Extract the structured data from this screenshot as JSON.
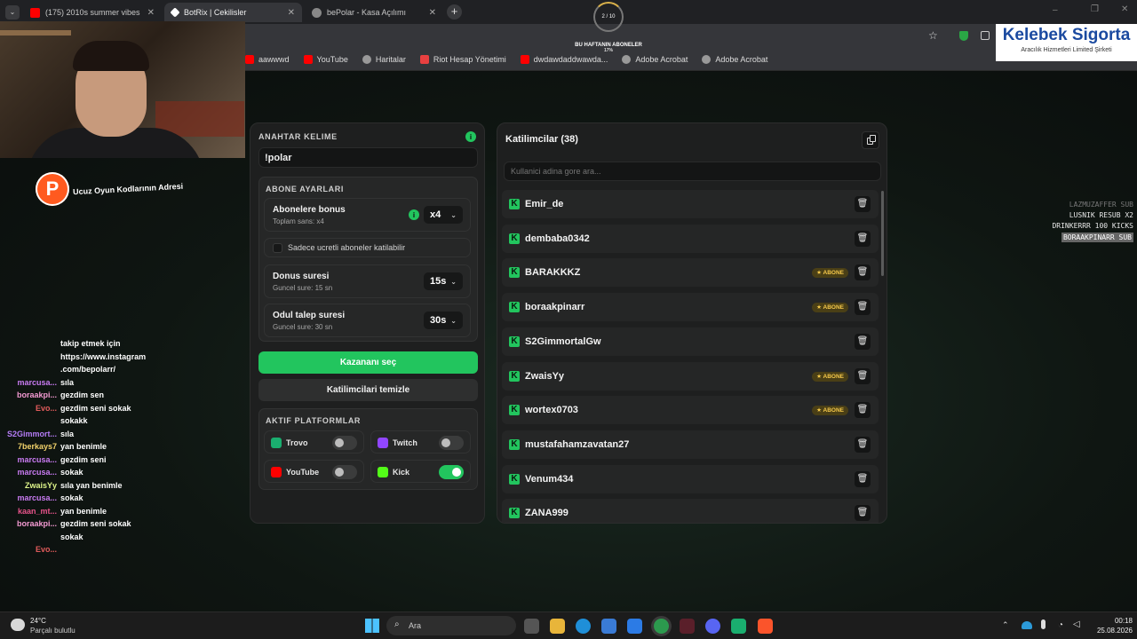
{
  "browser": {
    "tabs": [
      {
        "title": "(175) 2010s summer vibes mix",
        "fav_color": "#ff0000"
      },
      {
        "title": "BotRix | Cekilisler",
        "fav_color": "#ffffff"
      },
      {
        "title": "bePolar - Kasa Açılımı",
        "fav_color": "#888888"
      }
    ],
    "new_tab": "+",
    "bookmarks": [
      "aawwwd",
      "YouTube",
      "Haritalar",
      "Riot Hesap Yönetimi",
      "dwdawdaddwawda...",
      "Adobe Acrobat",
      "Adobe Acrobat"
    ]
  },
  "overlay": {
    "subs_banner": "BU HAFTANIN ABONELER",
    "subs_banner_sub": "17%",
    "progress_text": "2 / 10",
    "sponsor_name": "Kelebek Sigorta",
    "sponsor_sub": "Aracılık Hizmetleri Limited Şirketi",
    "logo_letter": "P",
    "logo_text": "Ucuz Oyun Kodlarının Adresi",
    "ticker": [
      "LAZMUZAFFER SUB",
      "LUSNIK RESUB X2",
      "DRINKERRR 100 KICKS",
      "BORAAKPINARR SUB"
    ]
  },
  "chat": [
    {
      "user": "",
      "color": "#ffffff",
      "msg": "takip etmek için"
    },
    {
      "user": "",
      "color": "#ffffff",
      "msg": "https://www.instagram"
    },
    {
      "user": "",
      "color": "#ffffff",
      "msg": ".com/bepolarr/"
    },
    {
      "user": "marcusa...",
      "color": "#c97bf2",
      "msg": "sıla"
    },
    {
      "user": "boraakpi...",
      "color": "#f39ad2",
      "msg": "gezdim sen"
    },
    {
      "user": "Evo...",
      "color": "#e05b5b",
      "msg": "gezdim seni sokak"
    },
    {
      "user": "",
      "color": "#ffffff",
      "msg": "sokakk"
    },
    {
      "user": "S2Gimmort...",
      "color": "#b47cf5",
      "msg": "sıla"
    },
    {
      "user": "7berkays7",
      "color": "#f3d36b",
      "msg": "yan benimle"
    },
    {
      "user": "marcusa...",
      "color": "#c97bf2",
      "msg": "gezdim seni"
    },
    {
      "user": "marcusa...",
      "color": "#c97bf2",
      "msg": "sokak"
    },
    {
      "user": "ZwaisYy",
      "color": "#dff58a",
      "msg": "sıla yan benimle"
    },
    {
      "user": "marcusa...",
      "color": "#c97bf2",
      "msg": "sokak"
    },
    {
      "user": "kaan_mt...",
      "color": "#e6538a",
      "msg": "yan benimle"
    },
    {
      "user": "boraakpi...",
      "color": "#f39ad2",
      "msg": "gezdim seni sokak"
    },
    {
      "user": "",
      "color": "#ffffff",
      "msg": "sokak"
    },
    {
      "user": "Evo...",
      "color": "#e05b5b",
      "msg": ""
    }
  ],
  "left_panel": {
    "keyword_label": "ANAHTAR KELIME",
    "keyword_value": "!polar",
    "abone_label": "ABONE AYARLARI",
    "bonus_title": "Abonelere bonus",
    "bonus_sub": "Toplam sans: x4",
    "bonus_value": "x4",
    "only_paid": "Sadece ucretli aboneler katilabilir",
    "spin_title": "Donus suresi",
    "spin_sub": "Guncel sure: 15 sn",
    "spin_value": "15s",
    "claim_title": "Odul talep suresi",
    "claim_sub": "Guncel sure: 30 sn",
    "claim_value": "30s",
    "pick_winner": "Kazananı seç",
    "clear_participants": "Katilimcilari temizle",
    "platforms_label": "AKTIF PLATFORMLAR",
    "platforms": [
      {
        "name": "Trovo",
        "on": false,
        "color": "#1aae6f"
      },
      {
        "name": "Twitch",
        "on": false,
        "color": "#9146ff"
      },
      {
        "name": "YouTube",
        "on": false,
        "color": "#ff0000"
      },
      {
        "name": "Kick",
        "on": true,
        "color": "#53fc18"
      }
    ]
  },
  "right_panel": {
    "title": "Katilimcilar (38)",
    "search_placeholder": "Kullanici adina gore ara...",
    "abone_badge": "★ ABONE",
    "participants": [
      {
        "name": "Emir_de",
        "abone": false
      },
      {
        "name": "dembaba0342",
        "abone": false
      },
      {
        "name": "BARAKKKZ",
        "abone": true
      },
      {
        "name": "boraakpinarr",
        "abone": true
      },
      {
        "name": "S2GimmortalGw",
        "abone": false
      },
      {
        "name": "ZwaisYy",
        "abone": true
      },
      {
        "name": "wortex0703",
        "abone": true
      },
      {
        "name": "mustafahamzavatan27",
        "abone": false
      },
      {
        "name": "Venum434",
        "abone": false
      },
      {
        "name": "ZANA999",
        "abone": false
      }
    ]
  },
  "taskbar": {
    "weather_temp": "24°C",
    "weather_desc": "Parçalı bulutlu",
    "search_label": "Ara",
    "time": "00:18",
    "date": "25.08.2026"
  }
}
